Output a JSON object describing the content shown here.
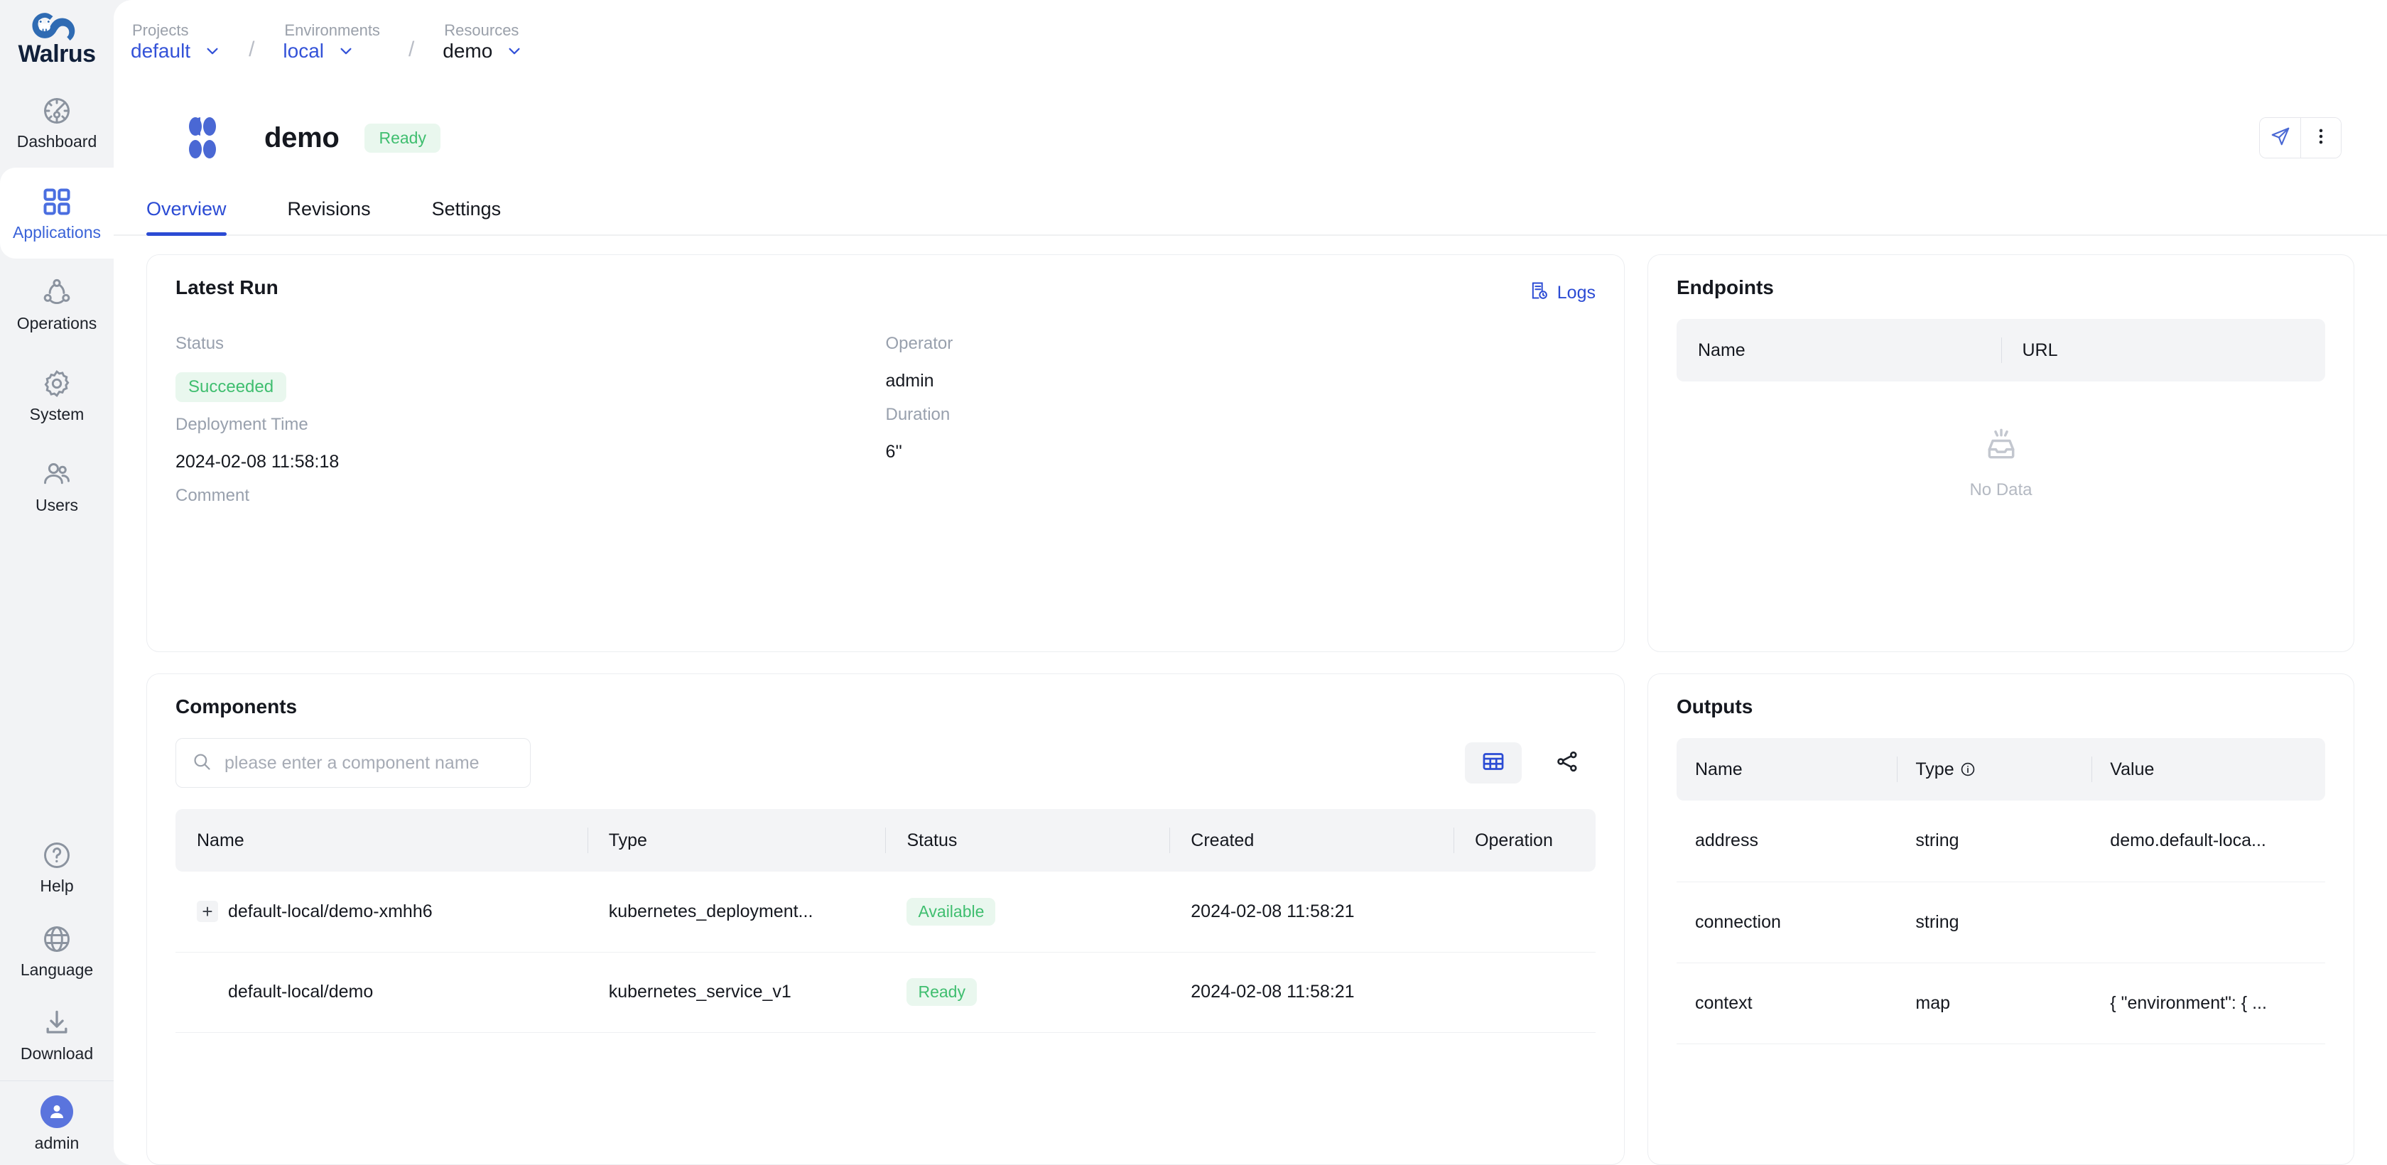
{
  "brand": {
    "name": "Walrus",
    "logo_icon": "walrus-logo-icon"
  },
  "sidebar": {
    "items": [
      {
        "label": "Dashboard",
        "icon": "dashboard-icon",
        "active": false
      },
      {
        "label": "Applications",
        "icon": "grid-icon",
        "active": true
      },
      {
        "label": "Operations",
        "icon": "operations-icon",
        "active": false
      },
      {
        "label": "System",
        "icon": "gear-icon",
        "active": false
      },
      {
        "label": "Users",
        "icon": "users-icon",
        "active": false
      }
    ],
    "bottom_items": [
      {
        "label": "Help",
        "icon": "question-circle-icon"
      },
      {
        "label": "Language",
        "icon": "globe-icon"
      },
      {
        "label": "Download",
        "icon": "download-icon"
      }
    ],
    "user": {
      "name": "admin",
      "icon": "avatar-icon"
    }
  },
  "breadcrumb": {
    "crumbs": [
      {
        "label": "Projects",
        "value": "default",
        "style": "link"
      },
      {
        "label": "Environments",
        "value": "local",
        "style": "link"
      },
      {
        "label": "Resources",
        "value": "demo",
        "style": "plain"
      }
    ],
    "separator": "/"
  },
  "header": {
    "title": "demo",
    "status_badge": "Ready",
    "actions": [
      {
        "name": "deploy-button",
        "icon": "send-icon"
      },
      {
        "name": "more-button",
        "icon": "more-vertical-icon"
      }
    ]
  },
  "tabs": [
    {
      "label": "Overview",
      "active": true
    },
    {
      "label": "Revisions",
      "active": false
    },
    {
      "label": "Settings",
      "active": false
    }
  ],
  "latest_run": {
    "title": "Latest Run",
    "logs_label": "Logs",
    "fields": {
      "status_label": "Status",
      "status_value": "Succeeded",
      "operator_label": "Operator",
      "operator_value": "admin",
      "deployment_time_label": "Deployment Time",
      "deployment_time_value": "2024-02-08 11:58:18",
      "duration_label": "Duration",
      "duration_value": "6''",
      "comment_label": "Comment",
      "comment_value": ""
    }
  },
  "endpoints": {
    "title": "Endpoints",
    "columns": [
      "Name",
      "URL"
    ],
    "rows": [],
    "empty_text": "No Data",
    "empty_icon": "inbox-icon"
  },
  "components": {
    "title": "Components",
    "search_placeholder": "please enter a component name",
    "search_value": "",
    "view_modes": [
      {
        "name": "table-view",
        "icon": "table-icon",
        "active": true
      },
      {
        "name": "graph-view",
        "icon": "graph-icon",
        "active": false
      }
    ],
    "columns": [
      "Name",
      "Type",
      "Status",
      "Created",
      "Operation"
    ],
    "rows": [
      {
        "expandable": true,
        "name": "default-local/demo-xmhh6",
        "type": "kubernetes_deployment...",
        "status": "Available",
        "created": "2024-02-08 11:58:21",
        "operation": ""
      },
      {
        "expandable": false,
        "name": "default-local/demo",
        "type": "kubernetes_service_v1",
        "status": "Ready",
        "created": "2024-02-08 11:58:21",
        "operation": ""
      }
    ]
  },
  "outputs": {
    "title": "Outputs",
    "columns": [
      "Name",
      "Type",
      "Value"
    ],
    "type_has_info_icon": true,
    "rows": [
      {
        "name": "address",
        "type": "string",
        "value": "demo.default-loca..."
      },
      {
        "name": "connection",
        "type": "string",
        "value": ""
      },
      {
        "name": "context",
        "type": "map",
        "value": "{ \"environment\": { ..."
      }
    ]
  },
  "colors": {
    "accent": "#2b4bd4",
    "brand_blue": "#3a63d8",
    "success_green": "#3fbe6f",
    "success_bg": "#e9f7ee",
    "page_bg": "#f2f3f5",
    "muted_text": "#98a0ad"
  }
}
